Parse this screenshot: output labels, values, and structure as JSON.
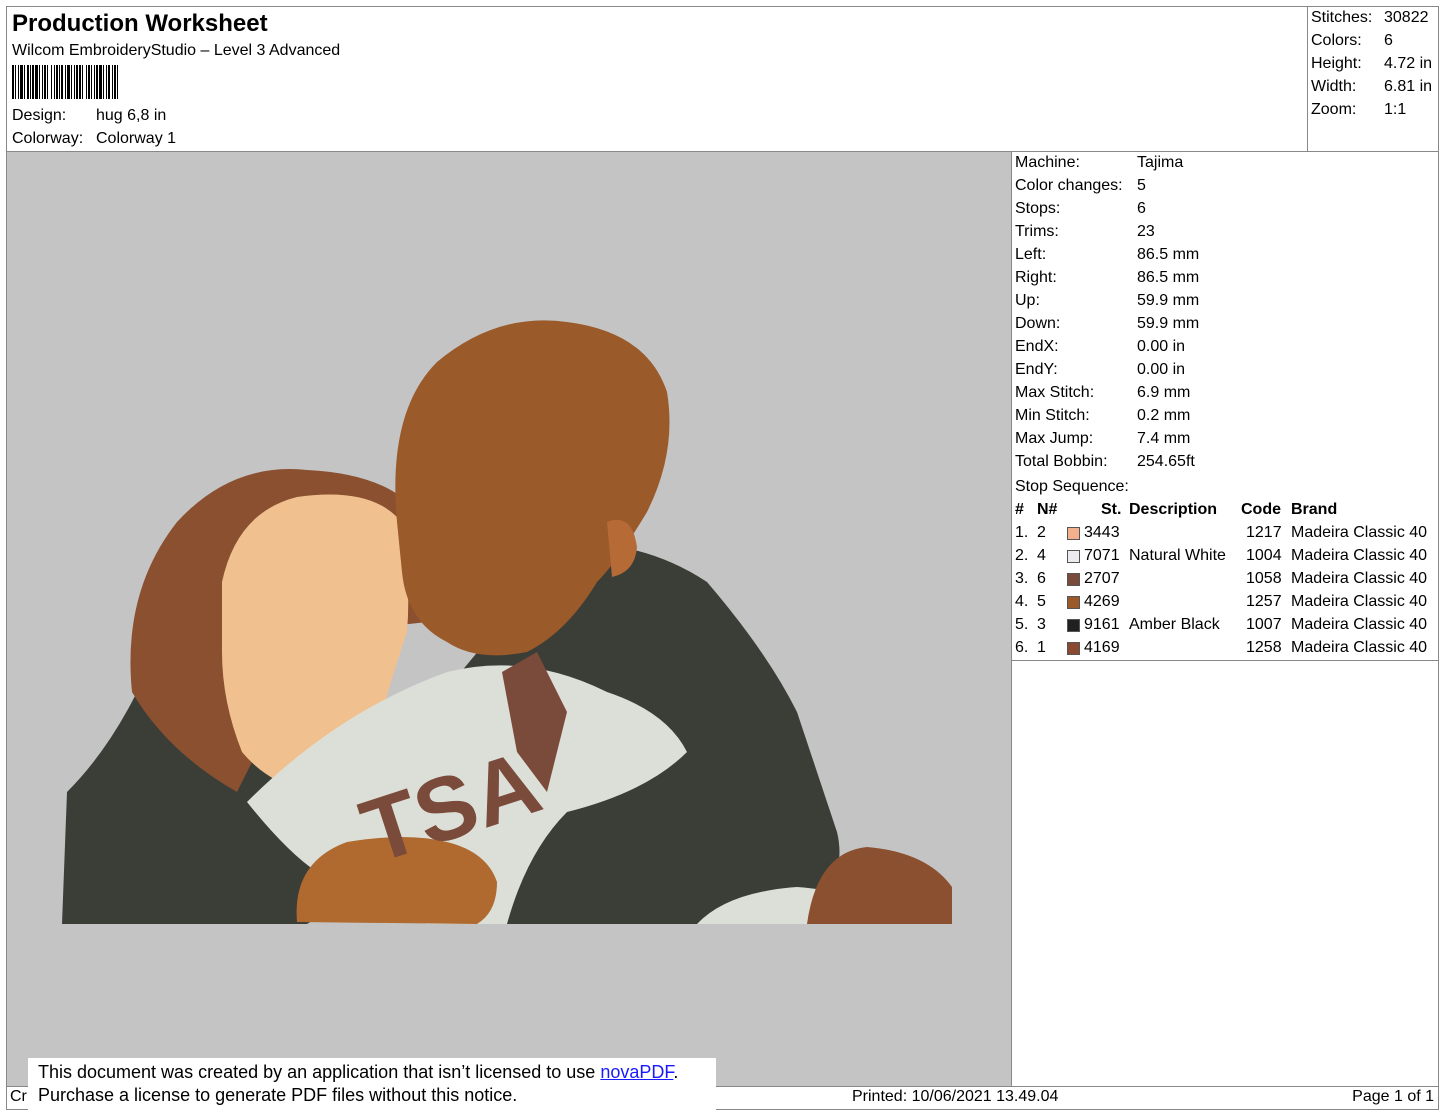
{
  "header": {
    "title": "Production Worksheet",
    "software": "Wilcom EmbroideryStudio – Level 3 Advanced",
    "design_label": "Design:",
    "design_value": "hug 6,8 in",
    "colorway_label": "Colorway:",
    "colorway_value": "Colorway 1"
  },
  "stats": [
    {
      "label": "Stitches:",
      "value": "30822"
    },
    {
      "label": "Colors:",
      "value": "6"
    },
    {
      "label": "Height:",
      "value": "4.72 in"
    },
    {
      "label": "Width:",
      "value": "6.81 in"
    },
    {
      "label": "Zoom:",
      "value": "1:1"
    }
  ],
  "machine_info": [
    {
      "label": "Machine:",
      "value": "Tajima"
    },
    {
      "label": "Color changes:",
      "value": "5"
    },
    {
      "label": "Stops:",
      "value": "6"
    },
    {
      "label": "Trims:",
      "value": "23"
    },
    {
      "label": "Left:",
      "value": "86.5 mm"
    },
    {
      "label": "Right:",
      "value": "86.5 mm"
    },
    {
      "label": "Up:",
      "value": "59.9 mm"
    },
    {
      "label": "Down:",
      "value": "59.9 mm"
    },
    {
      "label": "EndX:",
      "value": "0.00 in"
    },
    {
      "label": "EndY:",
      "value": "0.00 in"
    },
    {
      "label": "Max Stitch:",
      "value": "6.9 mm"
    },
    {
      "label": "Min Stitch:",
      "value": "0.2 mm"
    },
    {
      "label": "Max Jump:",
      "value": "7.4 mm"
    },
    {
      "label": "Total Bobbin:",
      "value": "254.65ft"
    }
  ],
  "stop_sequence": {
    "label": "Stop Sequence:",
    "columns": {
      "num": "#",
      "n": "N#",
      "st": "St.",
      "desc": "Description",
      "code": "Code",
      "brand": "Brand"
    },
    "rows": [
      {
        "num": "1.",
        "n": "2",
        "color": "#f2b08c",
        "st": "3443",
        "desc": "",
        "code": "1217",
        "brand": "Madeira Classic 40"
      },
      {
        "num": "2.",
        "n": "4",
        "color": "#ebebf0",
        "st": "7071",
        "desc": "Natural White",
        "code": "1004",
        "brand": "Madeira Classic 40"
      },
      {
        "num": "3.",
        "n": "6",
        "color": "#7a4a3a",
        "st": "2707",
        "desc": "",
        "code": "1058",
        "brand": "Madeira Classic 40"
      },
      {
        "num": "4.",
        "n": "5",
        "color": "#9a5a2a",
        "st": "4269",
        "desc": "",
        "code": "1257",
        "brand": "Madeira Classic 40"
      },
      {
        "num": "5.",
        "n": "3",
        "color": "#202020",
        "st": "9161",
        "desc": "Amber Black",
        "code": "1007",
        "brand": "Madeira Classic 40"
      },
      {
        "num": "6.",
        "n": "1",
        "color": "#8a4a32",
        "st": "4169",
        "desc": "",
        "code": "1258",
        "brand": "Madeira Classic 40"
      }
    ]
  },
  "design_text": "TSA",
  "footer": {
    "left": "Cr",
    "printed": "Printed: 10/06/2021 13.49.04",
    "page": "Page 1 of 1"
  },
  "notice": {
    "line1_prefix": "This document was created by an application that isn’t licensed to use ",
    "link": "novaPDF",
    "line1_suffix": ".",
    "line2": "Purchase a license to generate PDF files without this notice."
  }
}
